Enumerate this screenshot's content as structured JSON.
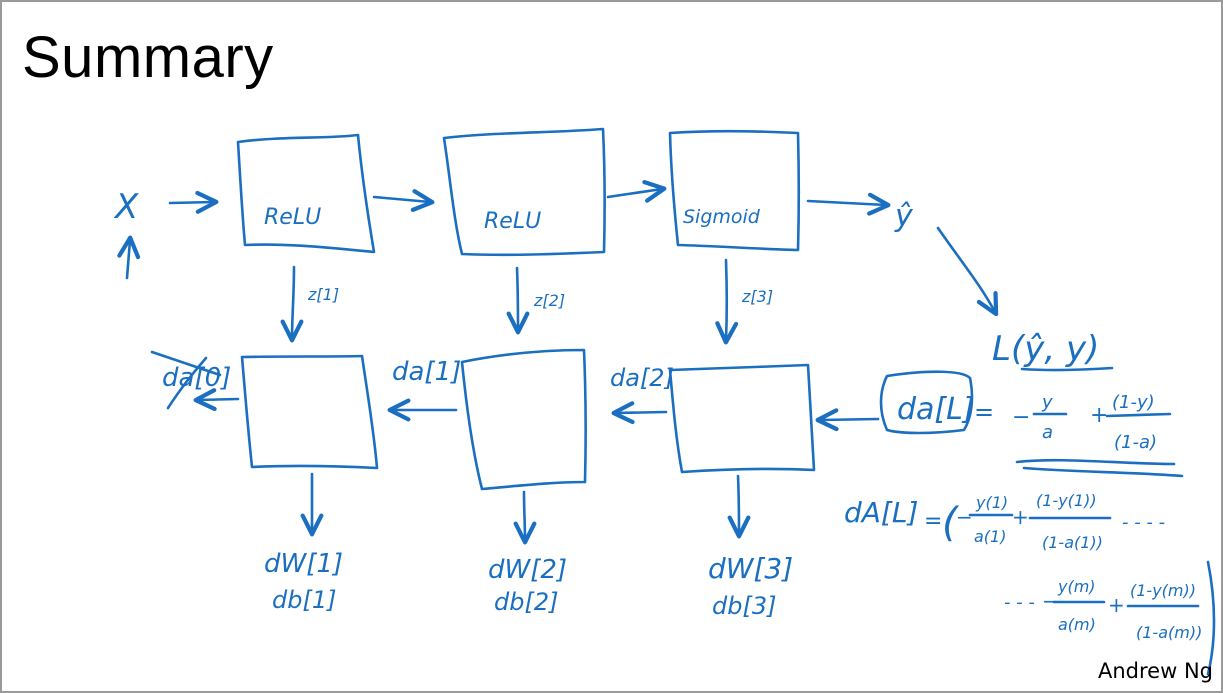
{
  "slide": {
    "title": "Summary",
    "author": "Andrew Ng"
  },
  "diagram": {
    "ink_color": "#1b6fc0",
    "input_label": "X",
    "output_label": "ŷ",
    "forward_blocks": [
      "ReLU",
      "ReLU",
      "Sigmoid"
    ],
    "cache_labels": [
      "z[1]",
      "z[2]",
      "z[3]"
    ],
    "backward_inputs": [
      "da[0]",
      "da[1]",
      "da[2]"
    ],
    "backward_outputs": [
      {
        "dw": "dW[1]",
        "db": "db[1]"
      },
      {
        "dw": "dW[2]",
        "db": "db[2]"
      },
      {
        "dw": "dW[3]",
        "db": "db[3]"
      }
    ],
    "loss": "L(ŷ, y)",
    "dL_label": "da[L]",
    "dL_formula": {
      "eq": "=",
      "t1_sign": "−",
      "t1_num": "y",
      "t1_den": "a",
      "t2_sign": "+",
      "t2_num": "(1-y)",
      "t2_den": "(1-a)"
    },
    "dA": {
      "label": "dA[L]",
      "eq": "=",
      "open": "(",
      "t1_sign": "−",
      "t1_num": "y(1)",
      "t1_den": "a(1)",
      "t2_sign": "+",
      "t2_num": "(1-y(1))",
      "t2_den": "(1-a(1))",
      "dots1": "- - - -",
      "dots2": "- - -",
      "t3_sign": "−",
      "t3_num": "y(m)",
      "t3_den": "a(m)",
      "t4_sign": "+",
      "t4_num": "(1-y(m))",
      "t4_den": "(1-a(m))"
    }
  }
}
